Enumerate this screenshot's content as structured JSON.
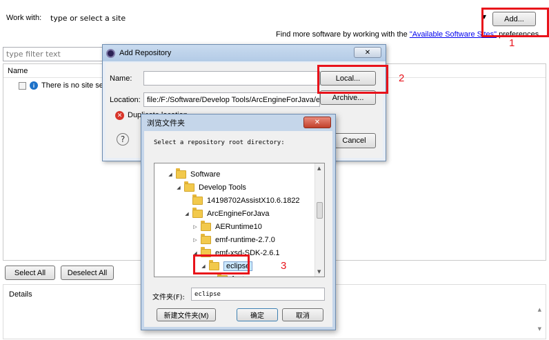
{
  "workwith": {
    "label": "Work with:",
    "value": "type or select a site",
    "add_button": "Add...",
    "find_more_prefix": "Find more software by working with the ",
    "find_more_link": "\"Available Software Sites\"",
    "find_more_suffix": " preferences."
  },
  "filter": {
    "placeholder": "type filter text"
  },
  "table": {
    "header": "Name",
    "empty_text": "There is no site se"
  },
  "buttons": {
    "select_all": "Select All",
    "deselect_all": "Deselect All"
  },
  "details": {
    "label": "Details"
  },
  "add_repository": {
    "title": "Add Repository",
    "name_label": "Name:",
    "name_value": "",
    "local_button": "Local...",
    "location_label": "Location:",
    "location_value": "file:/F:/Software/Develop Tools/ArcEngineForJava/er",
    "archive_button": "Archive...",
    "error_text": "Duplicate location",
    "cancel_button": "Cancel"
  },
  "browse": {
    "title": "浏览文件夹",
    "prompt": "Select a repository root directory:",
    "tree": [
      {
        "label": "Software",
        "level": 0,
        "toggle": "expanded"
      },
      {
        "label": "Develop Tools",
        "level": 1,
        "toggle": "expanded"
      },
      {
        "label": "14198702AssistX10.6.1822",
        "level": 2,
        "toggle": "none"
      },
      {
        "label": "ArcEngineForJava",
        "level": 2,
        "toggle": "expanded"
      },
      {
        "label": "AERuntime10",
        "level": 3,
        "toggle": "collapsed"
      },
      {
        "label": "emf-runtime-2.7.0",
        "level": 3,
        "toggle": "collapsed"
      },
      {
        "label": "emf-xsd-SDK-2.6.1",
        "level": 3,
        "toggle": "expanded"
      },
      {
        "label": "eclipse",
        "level": 4,
        "toggle": "expanded",
        "selected": true
      },
      {
        "label": "features",
        "level": 5,
        "toggle": "collapsed"
      }
    ],
    "folder_label": "文件夹(F):",
    "folder_value": "eclipse",
    "new_folder_button": "新建文件夹(M)",
    "ok_button": "确定",
    "cancel_button": "取消"
  },
  "annotations": {
    "one": "1",
    "two": "2",
    "three": "3"
  },
  "colors": {
    "annotation_red": "#e8121a",
    "selection_blue": "#cce8ff",
    "link_blue": "#0000ee"
  }
}
